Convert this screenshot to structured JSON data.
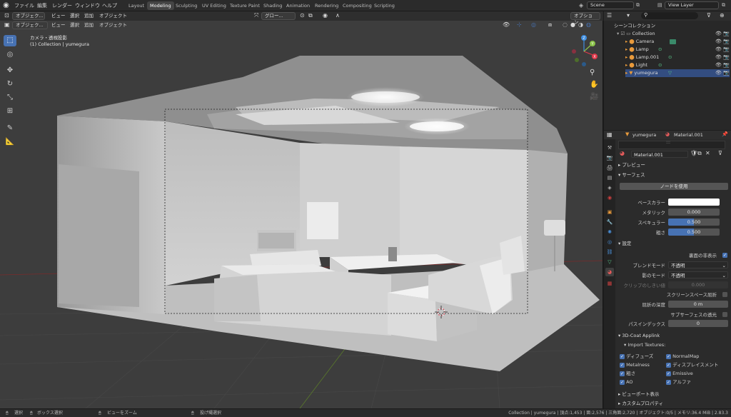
{
  "topbar": {
    "menus": [
      "ファイル",
      "編集",
      "レンダー",
      "ウィンドウ",
      "ヘルプ"
    ],
    "workspaces": [
      "Layout",
      "Modeling",
      "Sculpting",
      "UV Editing",
      "Texture Paint",
      "Shading",
      "Animation",
      "Rendering",
      "Compositing",
      "Scripting"
    ],
    "active_workspace": "Modeling",
    "scene": "Scene",
    "view_layer": "View Layer"
  },
  "viewport_header": {
    "mode": "オブジェク...",
    "menus": [
      "ビュー",
      "選択",
      "追加",
      "オブジェクト"
    ],
    "transform_orientation": "グロー...",
    "options": "オプション"
  },
  "viewport": {
    "camera_label": "カメラ・透視投影",
    "collection_label": "(1) Collection | yumegura",
    "gizmo_axes": [
      "X",
      "Y",
      "Z"
    ]
  },
  "outliner": {
    "root": "シーンコレクション",
    "collection": "Collection",
    "items": [
      {
        "name": "Camera",
        "icon": "camera-icon"
      },
      {
        "name": "Lamp",
        "icon": "lamp-icon"
      },
      {
        "name": "Lamp.001",
        "icon": "lamp-icon"
      },
      {
        "name": "Light",
        "icon": "lamp-icon"
      },
      {
        "name": "yumegura",
        "icon": "mesh-icon"
      }
    ]
  },
  "properties": {
    "object_name": "yumegura",
    "material_name": "Material.001",
    "material_slot": "Material.001",
    "preview_label": "プレビュー",
    "surface_label": "サーフェス",
    "use_nodes_label": "ノードを使用",
    "base_color_label": "ベースカラー",
    "metallic_label": "メタリック",
    "metallic_value": "0.000",
    "specular_label": "スペキュラー",
    "specular_value": "0.500",
    "roughness_label": "粗さ",
    "roughness_value": "0.500",
    "settings_label": "設定",
    "backface_label": "裏面の非表示",
    "blend_mode_label": "ブレンドモード",
    "blend_mode_value": "不透明",
    "shadow_mode_label": "影のモード",
    "shadow_mode_value": "不透明",
    "clip_threshold_label": "クリップのしきい値",
    "clip_threshold_value": "0.000",
    "screen_space_refraction_label": "スクリーンスペース屈折",
    "refraction_depth_label": "屈折の深度",
    "refraction_depth_value": "0 m",
    "subsurface_translucency_label": "サブサーフェスの透光",
    "pass_index_label": "パスインデックス",
    "pass_index_value": "0",
    "applink_label": "3D-Coat Applink",
    "import_textures_label": "Import Textures:",
    "textures": [
      {
        "label": "ディフューズ",
        "checked": true
      },
      {
        "label": "NormalMap",
        "checked": true
      },
      {
        "label": "Metalness",
        "checked": true
      },
      {
        "label": "ディスプレイスメント",
        "checked": true
      },
      {
        "label": "粗さ",
        "checked": true
      },
      {
        "label": "Emissive",
        "checked": true
      },
      {
        "label": "AO",
        "checked": true
      },
      {
        "label": "アルファ",
        "checked": true
      }
    ],
    "viewport_display_label": "ビューポート表示",
    "custom_props_label": "カスタムプロパティ"
  },
  "statusbar": {
    "select": "選択",
    "box_select": "ボックス選択",
    "zoom_view": "ビューをズーム",
    "lasso_select": "投げ縄選択",
    "stats": "Collection | yumegura | 頂点:1,453 | 面:2,576 | 三角面:2,720 | オブジェクト:0/5 | メモリ:36.4 MiB | 2.83.3"
  },
  "colors": {
    "accent": "#4772b3",
    "base_color": "#ffffff",
    "x_axis": "#e0394b",
    "y_axis": "#8bc34a",
    "z_axis": "#3f8ee0"
  }
}
